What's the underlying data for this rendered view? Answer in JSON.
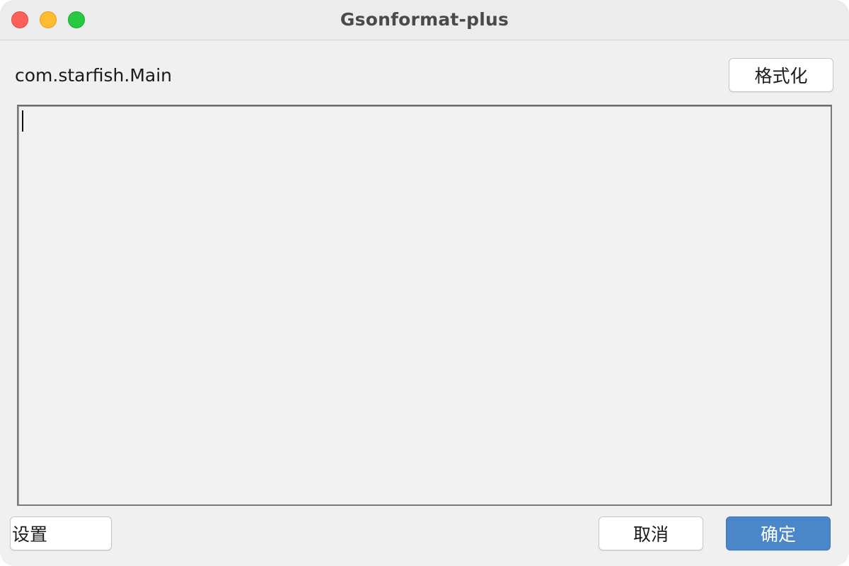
{
  "window": {
    "title": "Gsonformat-plus"
  },
  "header": {
    "class_name": "com.starfish.Main",
    "format_button_label": "格式化"
  },
  "editor": {
    "value": ""
  },
  "footer": {
    "settings_label": "设置",
    "cancel_label": "取消",
    "ok_label": "确定"
  },
  "colors": {
    "close": "#ff5f57",
    "minimize": "#febc2e",
    "zoom": "#28c840",
    "primary_button": "#4a86c8"
  },
  "icons": {
    "close": "close-icon",
    "minimize": "minimize-icon",
    "zoom": "zoom-icon"
  }
}
